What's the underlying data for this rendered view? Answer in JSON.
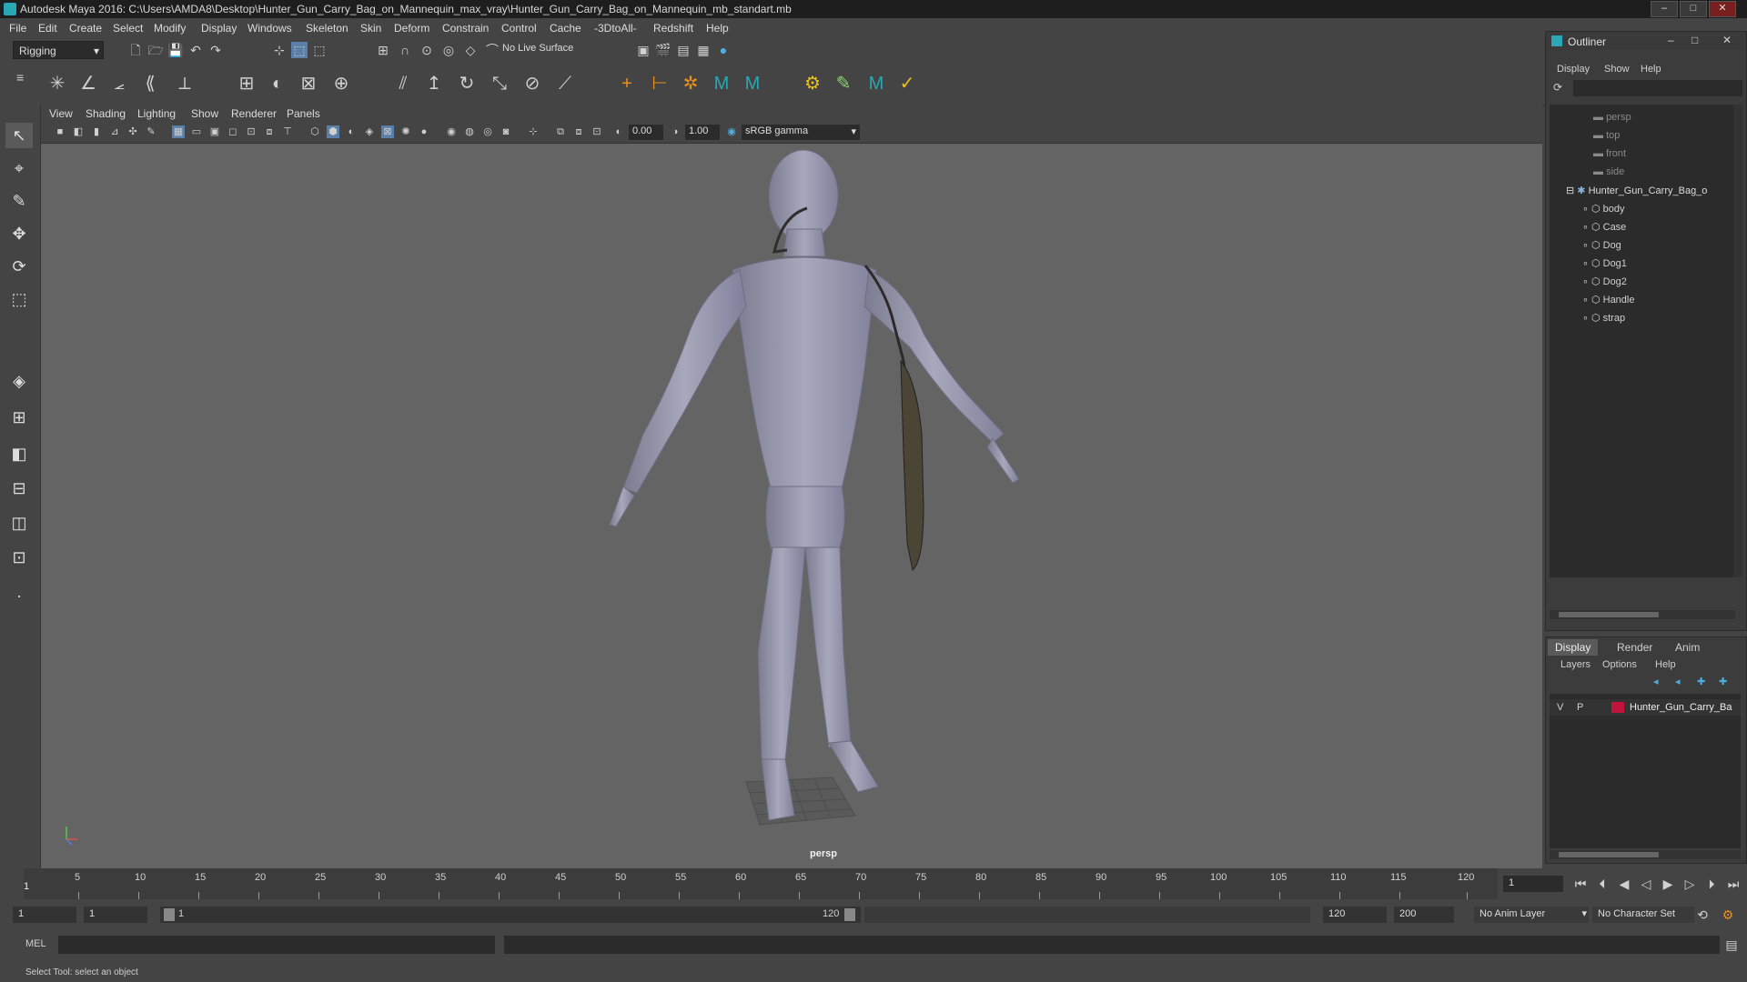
{
  "window": {
    "title": "Autodesk Maya 2016: C:\\Users\\AMDA8\\Desktop\\Hunter_Gun_Carry_Bag_on_Mannequin_max_vray\\Hunter_Gun_Carry_Bag_on_Mannequin_mb_standart.mb",
    "minimize": "–",
    "maximize": "□",
    "close": "✕"
  },
  "menu": [
    "File",
    "Edit",
    "Create",
    "Select",
    "Modify",
    "Display",
    "Windows",
    "Skeleton",
    "Skin",
    "Deform",
    "Constrain",
    "Control",
    "Cache",
    "-3DtoAll-",
    "Redshift",
    "Help"
  ],
  "statusline": {
    "mode": "Rigging",
    "live_surface": "No Live Surface"
  },
  "viewport": {
    "menu": [
      "View",
      "Shading",
      "Lighting",
      "Show",
      "Renderer",
      "Panels"
    ],
    "exposure": "0.00",
    "gamma": "1.00",
    "color_space": "sRGB gamma",
    "camera": "persp"
  },
  "outliner": {
    "title": "Outliner",
    "menu": [
      "Display",
      "Show",
      "Help"
    ],
    "cameras": [
      "persp",
      "top",
      "front",
      "side"
    ],
    "group": "Hunter_Gun_Carry_Bag_o",
    "children": [
      "body",
      "Case",
      "Dog",
      "Dog1",
      "Dog2",
      "Handle",
      "strap"
    ]
  },
  "layers": {
    "tabs": [
      "Display",
      "Render",
      "Anim"
    ],
    "menu": [
      "Layers",
      "Options",
      "Help"
    ],
    "row": {
      "v": "V",
      "p": "P",
      "name": "Hunter_Gun_Carry_Ba",
      "color": "#c0143c"
    }
  },
  "timeline": {
    "ticks": [
      "5",
      "10",
      "15",
      "20",
      "25",
      "30",
      "35",
      "40",
      "45",
      "50",
      "55",
      "60",
      "65",
      "70",
      "75",
      "80",
      "85",
      "90",
      "95",
      "100",
      "105",
      "110",
      "115",
      "120"
    ],
    "current_frame_label": "1",
    "current_frame": "1"
  },
  "range": {
    "start": "1",
    "playback_start": "1",
    "slider_start": "1",
    "slider_end": "120",
    "playback_end": "120",
    "end": "200",
    "anim_layer": "No Anim Layer",
    "character_set": "No Character Set"
  },
  "command": {
    "label": "MEL"
  },
  "help": {
    "text": "Select Tool: select an object"
  },
  "colors": {
    "accent": "#2aa7b5",
    "mannequin": "#9c9cb0",
    "layer_color": "#c0143c"
  }
}
